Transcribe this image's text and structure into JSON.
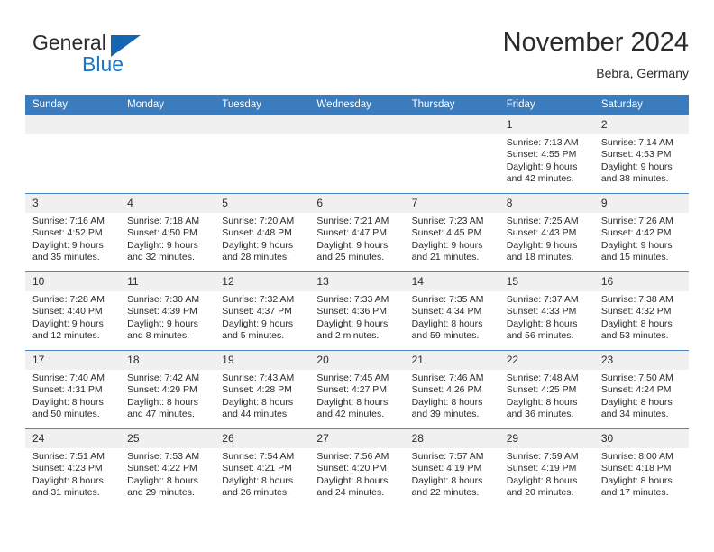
{
  "logo": {
    "word1": "General",
    "word2": "Blue",
    "triangle_color": "#1565b0",
    "word2_color": "#1a78c8"
  },
  "header": {
    "title": "November 2024",
    "subtitle": "Bebra, Germany"
  },
  "colors": {
    "header_row_bg": "#3a7cbe",
    "daynum_bg": "#f0f0f0",
    "row_border": "#4e86bf",
    "text": "#2b2b2b"
  },
  "weekdays": [
    "Sunday",
    "Monday",
    "Tuesday",
    "Wednesday",
    "Thursday",
    "Friday",
    "Saturday"
  ],
  "weeks": [
    [
      {
        "day": "",
        "empty": true,
        "sunrise": "",
        "sunset": "",
        "daylight1": "",
        "daylight2": ""
      },
      {
        "day": "",
        "empty": true,
        "sunrise": "",
        "sunset": "",
        "daylight1": "",
        "daylight2": ""
      },
      {
        "day": "",
        "empty": true,
        "sunrise": "",
        "sunset": "",
        "daylight1": "",
        "daylight2": ""
      },
      {
        "day": "",
        "empty": true,
        "sunrise": "",
        "sunset": "",
        "daylight1": "",
        "daylight2": ""
      },
      {
        "day": "",
        "empty": true,
        "sunrise": "",
        "sunset": "",
        "daylight1": "",
        "daylight2": ""
      },
      {
        "day": "1",
        "empty": false,
        "sunrise": "Sunrise: 7:13 AM",
        "sunset": "Sunset: 4:55 PM",
        "daylight1": "Daylight: 9 hours",
        "daylight2": "and 42 minutes."
      },
      {
        "day": "2",
        "empty": false,
        "sunrise": "Sunrise: 7:14 AM",
        "sunset": "Sunset: 4:53 PM",
        "daylight1": "Daylight: 9 hours",
        "daylight2": "and 38 minutes."
      }
    ],
    [
      {
        "day": "3",
        "empty": false,
        "sunrise": "Sunrise: 7:16 AM",
        "sunset": "Sunset: 4:52 PM",
        "daylight1": "Daylight: 9 hours",
        "daylight2": "and 35 minutes."
      },
      {
        "day": "4",
        "empty": false,
        "sunrise": "Sunrise: 7:18 AM",
        "sunset": "Sunset: 4:50 PM",
        "daylight1": "Daylight: 9 hours",
        "daylight2": "and 32 minutes."
      },
      {
        "day": "5",
        "empty": false,
        "sunrise": "Sunrise: 7:20 AM",
        "sunset": "Sunset: 4:48 PM",
        "daylight1": "Daylight: 9 hours",
        "daylight2": "and 28 minutes."
      },
      {
        "day": "6",
        "empty": false,
        "sunrise": "Sunrise: 7:21 AM",
        "sunset": "Sunset: 4:47 PM",
        "daylight1": "Daylight: 9 hours",
        "daylight2": "and 25 minutes."
      },
      {
        "day": "7",
        "empty": false,
        "sunrise": "Sunrise: 7:23 AM",
        "sunset": "Sunset: 4:45 PM",
        "daylight1": "Daylight: 9 hours",
        "daylight2": "and 21 minutes."
      },
      {
        "day": "8",
        "empty": false,
        "sunrise": "Sunrise: 7:25 AM",
        "sunset": "Sunset: 4:43 PM",
        "daylight1": "Daylight: 9 hours",
        "daylight2": "and 18 minutes."
      },
      {
        "day": "9",
        "empty": false,
        "sunrise": "Sunrise: 7:26 AM",
        "sunset": "Sunset: 4:42 PM",
        "daylight1": "Daylight: 9 hours",
        "daylight2": "and 15 minutes."
      }
    ],
    [
      {
        "day": "10",
        "empty": false,
        "sunrise": "Sunrise: 7:28 AM",
        "sunset": "Sunset: 4:40 PM",
        "daylight1": "Daylight: 9 hours",
        "daylight2": "and 12 minutes."
      },
      {
        "day": "11",
        "empty": false,
        "sunrise": "Sunrise: 7:30 AM",
        "sunset": "Sunset: 4:39 PM",
        "daylight1": "Daylight: 9 hours",
        "daylight2": "and 8 minutes."
      },
      {
        "day": "12",
        "empty": false,
        "sunrise": "Sunrise: 7:32 AM",
        "sunset": "Sunset: 4:37 PM",
        "daylight1": "Daylight: 9 hours",
        "daylight2": "and 5 minutes."
      },
      {
        "day": "13",
        "empty": false,
        "sunrise": "Sunrise: 7:33 AM",
        "sunset": "Sunset: 4:36 PM",
        "daylight1": "Daylight: 9 hours",
        "daylight2": "and 2 minutes."
      },
      {
        "day": "14",
        "empty": false,
        "sunrise": "Sunrise: 7:35 AM",
        "sunset": "Sunset: 4:34 PM",
        "daylight1": "Daylight: 8 hours",
        "daylight2": "and 59 minutes."
      },
      {
        "day": "15",
        "empty": false,
        "sunrise": "Sunrise: 7:37 AM",
        "sunset": "Sunset: 4:33 PM",
        "daylight1": "Daylight: 8 hours",
        "daylight2": "and 56 minutes."
      },
      {
        "day": "16",
        "empty": false,
        "sunrise": "Sunrise: 7:38 AM",
        "sunset": "Sunset: 4:32 PM",
        "daylight1": "Daylight: 8 hours",
        "daylight2": "and 53 minutes."
      }
    ],
    [
      {
        "day": "17",
        "empty": false,
        "sunrise": "Sunrise: 7:40 AM",
        "sunset": "Sunset: 4:31 PM",
        "daylight1": "Daylight: 8 hours",
        "daylight2": "and 50 minutes."
      },
      {
        "day": "18",
        "empty": false,
        "sunrise": "Sunrise: 7:42 AM",
        "sunset": "Sunset: 4:29 PM",
        "daylight1": "Daylight: 8 hours",
        "daylight2": "and 47 minutes."
      },
      {
        "day": "19",
        "empty": false,
        "sunrise": "Sunrise: 7:43 AM",
        "sunset": "Sunset: 4:28 PM",
        "daylight1": "Daylight: 8 hours",
        "daylight2": "and 44 minutes."
      },
      {
        "day": "20",
        "empty": false,
        "sunrise": "Sunrise: 7:45 AM",
        "sunset": "Sunset: 4:27 PM",
        "daylight1": "Daylight: 8 hours",
        "daylight2": "and 42 minutes."
      },
      {
        "day": "21",
        "empty": false,
        "sunrise": "Sunrise: 7:46 AM",
        "sunset": "Sunset: 4:26 PM",
        "daylight1": "Daylight: 8 hours",
        "daylight2": "and 39 minutes."
      },
      {
        "day": "22",
        "empty": false,
        "sunrise": "Sunrise: 7:48 AM",
        "sunset": "Sunset: 4:25 PM",
        "daylight1": "Daylight: 8 hours",
        "daylight2": "and 36 minutes."
      },
      {
        "day": "23",
        "empty": false,
        "sunrise": "Sunrise: 7:50 AM",
        "sunset": "Sunset: 4:24 PM",
        "daylight1": "Daylight: 8 hours",
        "daylight2": "and 34 minutes."
      }
    ],
    [
      {
        "day": "24",
        "empty": false,
        "sunrise": "Sunrise: 7:51 AM",
        "sunset": "Sunset: 4:23 PM",
        "daylight1": "Daylight: 8 hours",
        "daylight2": "and 31 minutes."
      },
      {
        "day": "25",
        "empty": false,
        "sunrise": "Sunrise: 7:53 AM",
        "sunset": "Sunset: 4:22 PM",
        "daylight1": "Daylight: 8 hours",
        "daylight2": "and 29 minutes."
      },
      {
        "day": "26",
        "empty": false,
        "sunrise": "Sunrise: 7:54 AM",
        "sunset": "Sunset: 4:21 PM",
        "daylight1": "Daylight: 8 hours",
        "daylight2": "and 26 minutes."
      },
      {
        "day": "27",
        "empty": false,
        "sunrise": "Sunrise: 7:56 AM",
        "sunset": "Sunset: 4:20 PM",
        "daylight1": "Daylight: 8 hours",
        "daylight2": "and 24 minutes."
      },
      {
        "day": "28",
        "empty": false,
        "sunrise": "Sunrise: 7:57 AM",
        "sunset": "Sunset: 4:19 PM",
        "daylight1": "Daylight: 8 hours",
        "daylight2": "and 22 minutes."
      },
      {
        "day": "29",
        "empty": false,
        "sunrise": "Sunrise: 7:59 AM",
        "sunset": "Sunset: 4:19 PM",
        "daylight1": "Daylight: 8 hours",
        "daylight2": "and 20 minutes."
      },
      {
        "day": "30",
        "empty": false,
        "sunrise": "Sunrise: 8:00 AM",
        "sunset": "Sunset: 4:18 PM",
        "daylight1": "Daylight: 8 hours",
        "daylight2": "and 17 minutes."
      }
    ]
  ]
}
